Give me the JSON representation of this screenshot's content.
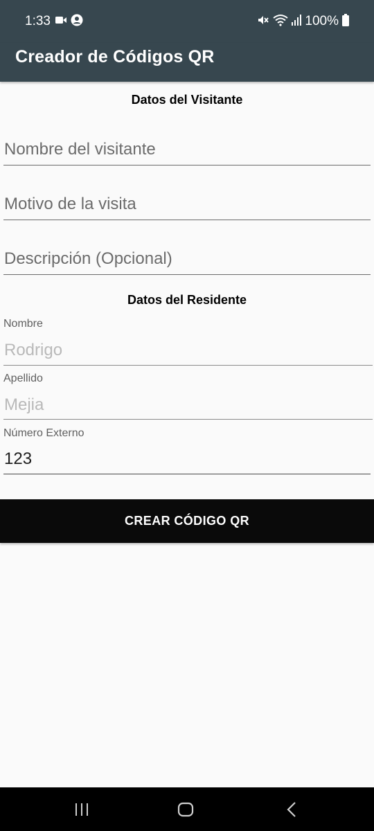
{
  "status_bar": {
    "time": "1:33",
    "battery": "100%",
    "icons": [
      "video-icon",
      "account-circle-icon",
      "mute-icon",
      "wifi-icon",
      "signal-icon",
      "battery-icon"
    ]
  },
  "app_bar": {
    "title": "Creador de Códigos QR",
    "color": "#37474f"
  },
  "visitor_section": {
    "title": "Datos del Visitante",
    "fields": {
      "name_placeholder": "Nombre del visitante",
      "reason_placeholder": "Motivo de la visita",
      "description_placeholder": "Descripción (Opcional)"
    }
  },
  "resident_section": {
    "title": "Datos del Residente",
    "first_name": {
      "label": "Nombre",
      "value": "Rodrigo"
    },
    "last_name": {
      "label": "Apellido",
      "value": "Mejia"
    },
    "external_number": {
      "label": "Número Externo",
      "value": "123"
    }
  },
  "actions": {
    "create_label": "CREAR CÓDIGO QR"
  },
  "nav_bar": {
    "icons": [
      "recent-apps-icon",
      "home-icon",
      "back-icon"
    ]
  }
}
